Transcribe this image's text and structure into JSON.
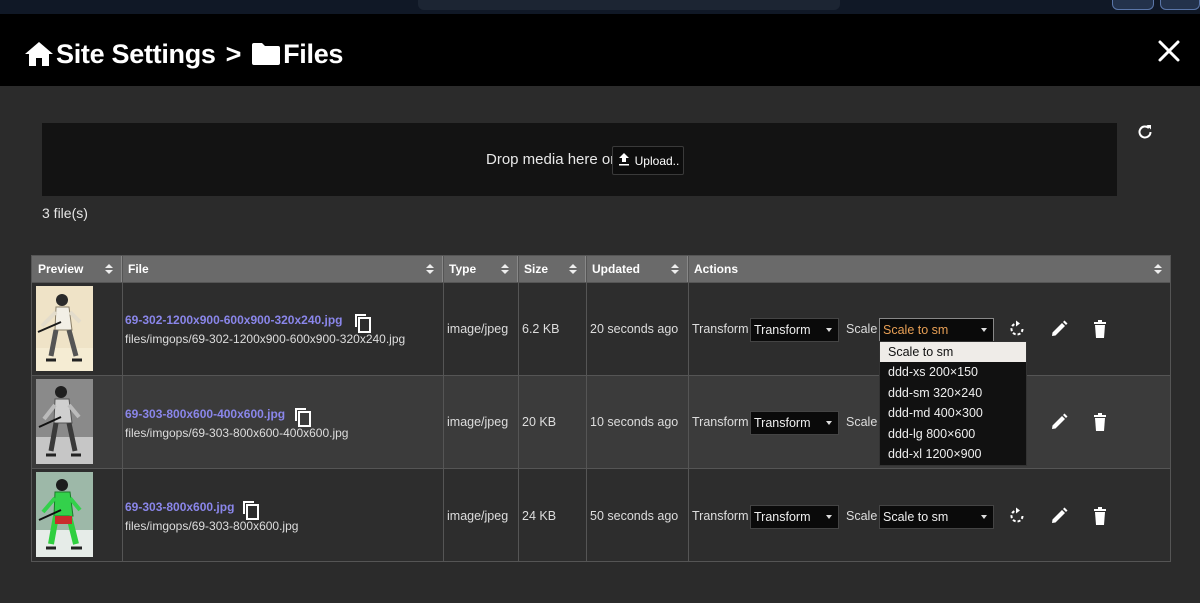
{
  "header": {
    "title": "Site Settings",
    "separator": ">",
    "section": "Files"
  },
  "upload": {
    "drop_text": "Drop media here or",
    "button_label": "Upload.."
  },
  "file_count": "3 file(s)",
  "table": {
    "columns": [
      "Preview",
      "File",
      "Type",
      "Size",
      "Updated",
      "Actions"
    ],
    "rows": [
      {
        "name": "69-302-1200x900-600x900-320x240.jpg",
        "path": "files/imgops/69-302-1200x900-600x900-320x240.jpg",
        "type": "image/jpeg",
        "size": "6.2 KB",
        "updated": "20 seconds ago",
        "transform_label": "Transform",
        "transform_value": "Transform",
        "scale_label": "Scale",
        "scale_value": "Scale to sm"
      },
      {
        "name": "69-303-800x600-400x600.jpg",
        "path": "files/imgops/69-303-800x600-400x600.jpg",
        "type": "image/jpeg",
        "size": "20 KB",
        "updated": "10 seconds ago",
        "transform_label": "Transform",
        "transform_value": "Transform",
        "scale_label": "Scale",
        "scale_value": ""
      },
      {
        "name": "69-303-800x600.jpg",
        "path": "files/imgops/69-303-800x600.jpg",
        "type": "image/jpeg",
        "size": "24 KB",
        "updated": "50 seconds ago",
        "transform_label": "Transform",
        "transform_value": "Transform",
        "scale_label": "Scale",
        "scale_value": "Scale to sm"
      }
    ]
  },
  "scale_dropdown": {
    "options": [
      "Scale to sm",
      "ddd-xs 200×150",
      "ddd-sm 320×240",
      "ddd-md 400×300",
      "ddd-lg 800×600",
      "ddd-xl 1200×900"
    ],
    "highlighted": "Scale to sm"
  },
  "colors": {
    "file_link": "#8a86ea",
    "open_select_text": "#e79f55",
    "header_bg": "#000000",
    "table_header_bg": "#6a6a6a"
  },
  "icons": {
    "home": "home-icon",
    "folder": "folder-icon",
    "close": "close-icon",
    "upload": "upload-icon",
    "refresh": "refresh-icon",
    "copy": "copy-icon",
    "rotate": "rotate-icon",
    "edit": "pencil-icon",
    "delete": "trash-icon",
    "sort": "sort-icon"
  }
}
